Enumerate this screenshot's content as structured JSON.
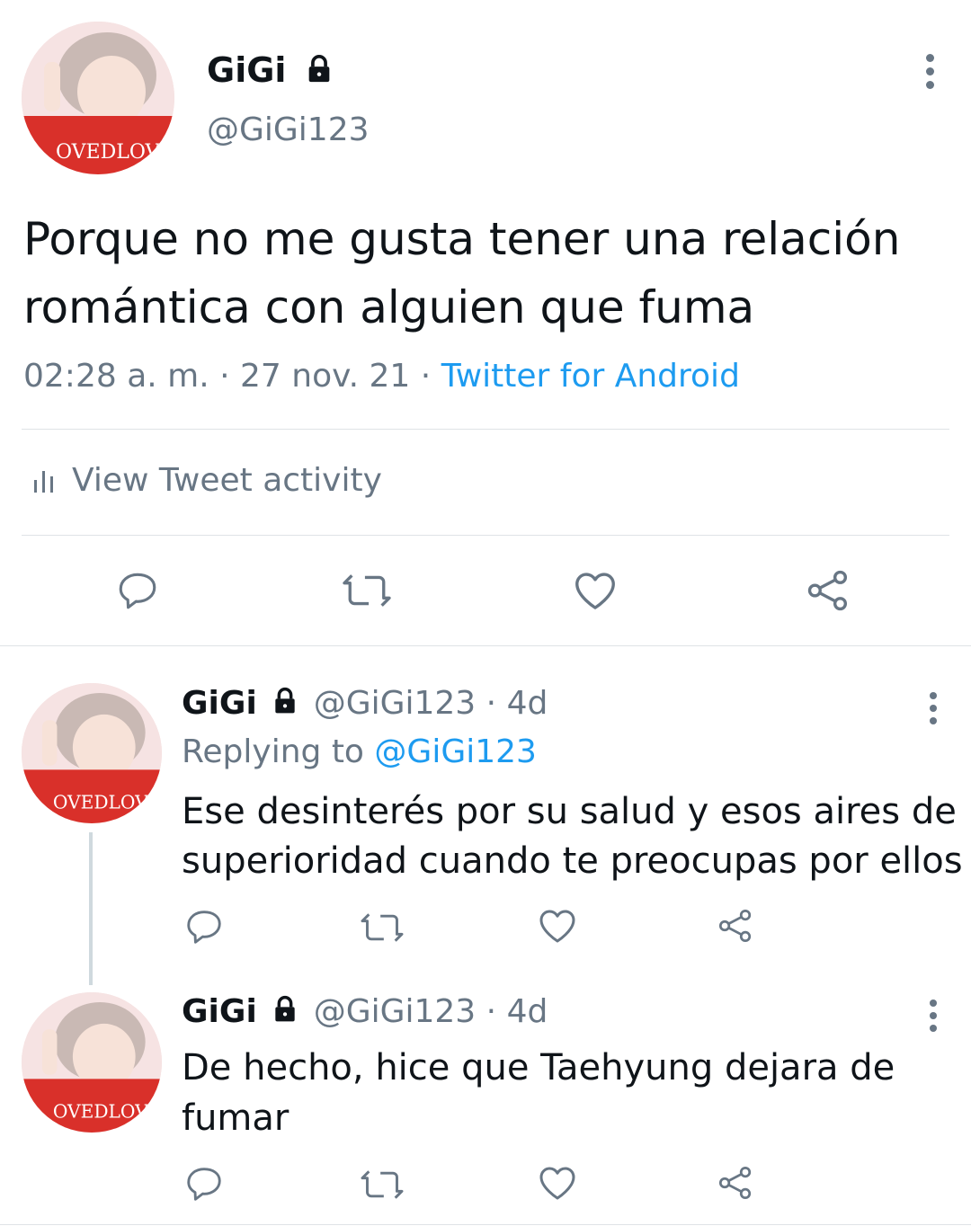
{
  "main_tweet": {
    "display_name": "GiGi",
    "handle": "@GiGi123",
    "text_line1": "Porque no me gusta tener una relación",
    "text_line2": "romántica con alguien que fuma",
    "time": "02:28 a. m.",
    "sep1": "·",
    "date": "27 nov. 21",
    "sep2": "·",
    "source": "Twitter for Android",
    "activity_label": "View Tweet activity",
    "avatar_text": "OVEDLOVE"
  },
  "replies": [
    {
      "display_name": "GiGi",
      "handle": "@GiGi123",
      "dot": "·",
      "age": "4d",
      "replying_prefix": "Replying to",
      "replying_handle": "@GiGi123",
      "text_line1": "Ese desinterés por su salud y esos aires de",
      "text_line2": "superioridad cuando te preocupas por ellos",
      "avatar_text": "OVEDLOVE"
    },
    {
      "display_name": "GiGi",
      "handle": "@GiGi123",
      "dot": "·",
      "age": "4d",
      "text_line1": "De hecho, hice que Taehyung dejara de",
      "text_line2": "fumar",
      "avatar_text": "OVEDLOVE"
    }
  ],
  "icons": {
    "reply": "reply-icon",
    "retweet": "retweet-icon",
    "like": "like-icon",
    "share": "share-icon",
    "lock": "lock-icon",
    "more": "more-icon",
    "activity": "activity-icon"
  },
  "colors": {
    "text": "#0f1419",
    "muted": "#687684",
    "link": "#1d9bf0",
    "divider": "#dfe3e6"
  }
}
